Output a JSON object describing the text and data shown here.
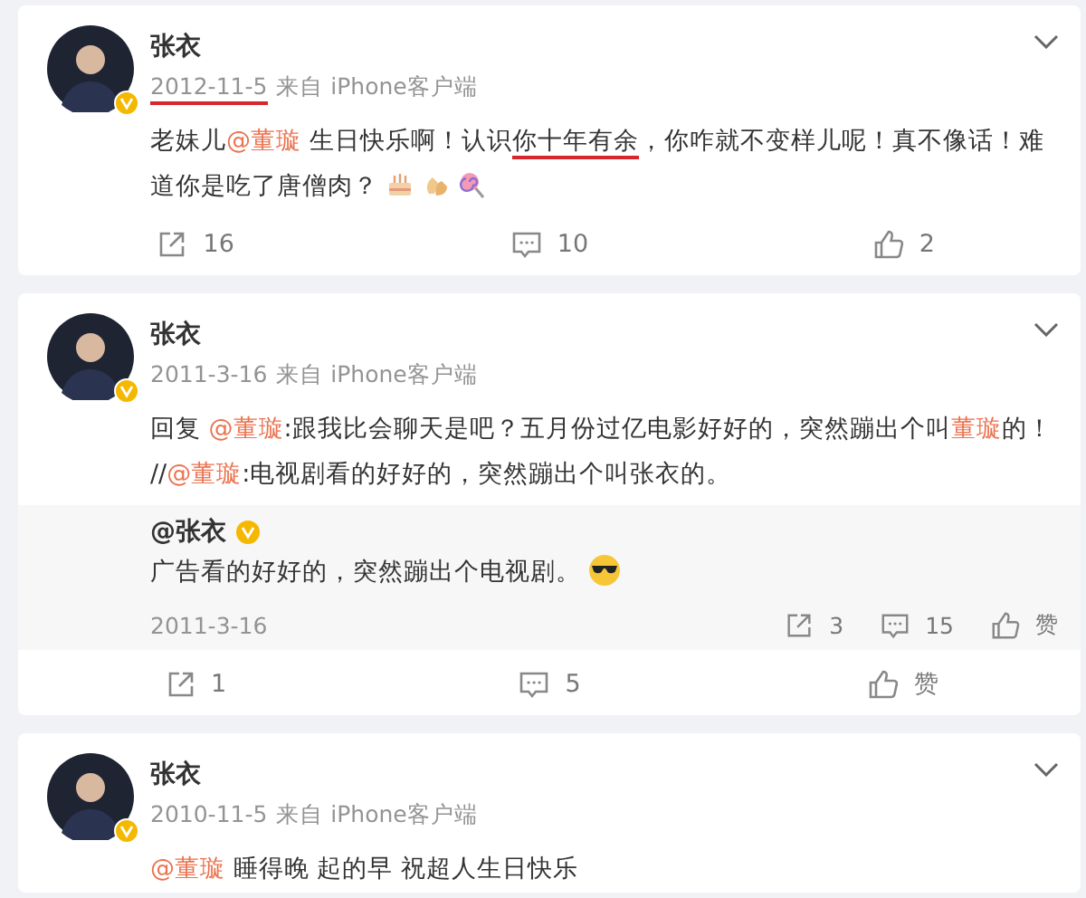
{
  "posts": [
    {
      "author": "张衣",
      "verified": true,
      "date": "2012-11-5",
      "date_marked": true,
      "source": "来自 iPhone客户端",
      "lines": [
        [
          {
            "kind": "text",
            "text": "老妹儿"
          },
          {
            "kind": "mention",
            "text": "@董璇"
          },
          {
            "kind": "text",
            "text": " 生日快乐啊！认识"
          },
          {
            "kind": "text",
            "text": "你十年有余",
            "marked": true
          },
          {
            "kind": "text",
            "text": "，你咋就不变样儿呢！真不像话！难"
          }
        ],
        [
          {
            "kind": "text",
            "text": "道你是吃了唐僧肉？"
          },
          {
            "kind": "emoji"
          },
          {
            "kind": "emoji"
          },
          {
            "kind": "emoji"
          }
        ]
      ],
      "actions": [
        {
          "kind": "share",
          "label": "16"
        },
        {
          "kind": "comment",
          "label": "10"
        },
        {
          "kind": "like",
          "label": "2"
        }
      ]
    },
    {
      "author": "张衣",
      "verified": true,
      "date": "2011-3-16",
      "date_marked": false,
      "source": "来自 iPhone客户端",
      "lines": [
        [
          {
            "kind": "text",
            "text": "回复 "
          },
          {
            "kind": "mention",
            "text": "@董璇"
          },
          {
            "kind": "text",
            "text": ":跟我比会聊天是吧？五月份过亿电影好好的，突然蹦出个叫"
          },
          {
            "kind": "mention",
            "text": "董璇"
          },
          {
            "kind": "text",
            "text": "的！"
          }
        ],
        [
          {
            "kind": "text",
            "text": "//"
          },
          {
            "kind": "mention",
            "text": "@董璇"
          },
          {
            "kind": "text",
            "text": ":电视剧看的好好的，突然蹦出个叫张衣的。"
          }
        ]
      ],
      "retweet": {
        "author": "@张衣",
        "verified": true,
        "lines": [
          [
            {
              "kind": "text",
              "text": "广告看的好好的，突然蹦出个电视剧。"
            },
            {
              "kind": "emoji"
            }
          ]
        ],
        "date": "2011-3-16",
        "actions": [
          {
            "kind": "share",
            "label": "3"
          },
          {
            "kind": "comment",
            "label": "15"
          },
          {
            "kind": "like",
            "label": "赞"
          }
        ]
      },
      "actions": [
        {
          "kind": "share",
          "label": "1"
        },
        {
          "kind": "comment",
          "label": "5"
        },
        {
          "kind": "like",
          "label": "赞"
        }
      ]
    },
    {
      "author": "张衣",
      "verified": true,
      "date": "2010-11-5",
      "date_marked": false,
      "source": "来自 iPhone客户端",
      "lines": [
        [
          {
            "kind": "mention",
            "text": "@董璇"
          },
          {
            "kind": "text",
            "text": " 睡得晚 起的早 祝超人生日快乐"
          }
        ]
      ]
    }
  ]
}
